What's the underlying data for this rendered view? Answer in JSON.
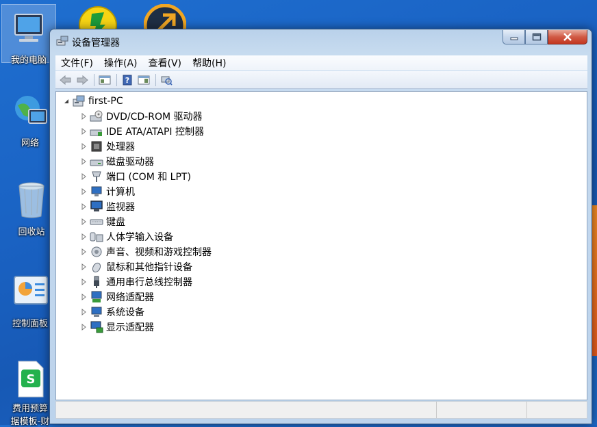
{
  "desktop": {
    "icons": [
      {
        "label": "我的电脑"
      },
      {
        "label": "网络"
      },
      {
        "label": "回收站"
      },
      {
        "label": "控制面板"
      },
      {
        "label": "费用预算"
      },
      {
        "label": "据模板-财"
      }
    ]
  },
  "window": {
    "title": "设备管理器",
    "menu": [
      "文件(F)",
      "操作(A)",
      "查看(V)",
      "帮助(H)"
    ],
    "tree": {
      "root": "first-PC",
      "children": [
        {
          "label": "DVD/CD-ROM 驱动器",
          "icon": "dvd-drive-icon"
        },
        {
          "label": "IDE ATA/ATAPI 控制器",
          "icon": "ide-controller-icon"
        },
        {
          "label": "处理器",
          "icon": "processor-icon"
        },
        {
          "label": "磁盘驱动器",
          "icon": "disk-drive-icon"
        },
        {
          "label": "端口 (COM 和 LPT)",
          "icon": "port-icon"
        },
        {
          "label": "计算机",
          "icon": "computer-icon"
        },
        {
          "label": "监视器",
          "icon": "monitor-icon"
        },
        {
          "label": "键盘",
          "icon": "keyboard-icon"
        },
        {
          "label": "人体学输入设备",
          "icon": "hid-icon"
        },
        {
          "label": "声音、视频和游戏控制器",
          "icon": "sound-icon"
        },
        {
          "label": "鼠标和其他指针设备",
          "icon": "mouse-icon"
        },
        {
          "label": "通用串行总线控制器",
          "icon": "usb-icon"
        },
        {
          "label": "网络适配器",
          "icon": "network-adapter-icon"
        },
        {
          "label": "系统设备",
          "icon": "system-device-icon"
        },
        {
          "label": "显示适配器",
          "icon": "display-adapter-icon"
        }
      ]
    }
  }
}
